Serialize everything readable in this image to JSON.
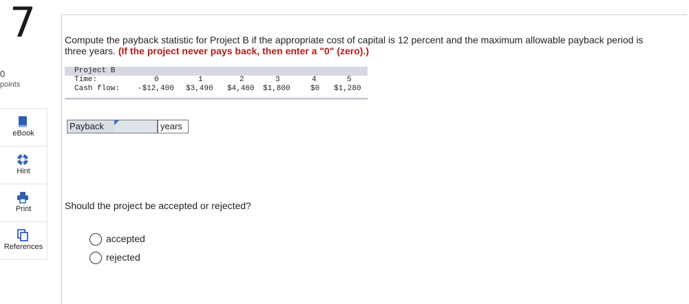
{
  "question_number": "7",
  "points": {
    "value": "0",
    "label": "points"
  },
  "rail": [
    {
      "label": "eBook",
      "icon": "ebook-icon"
    },
    {
      "label": "Hint",
      "icon": "hint-icon"
    },
    {
      "label": "Print",
      "icon": "print-icon"
    },
    {
      "label": "References",
      "icon": "references-icon"
    }
  ],
  "question": {
    "text": "Compute the payback statistic for Project B if the appropriate cost of capital is 12 percent and the maximum allowable payback period is three years. ",
    "bold": "(If the project never pays back, then enter a \"0\" (zero).)"
  },
  "cashflow": {
    "project": "Project B",
    "time_label": "Time:",
    "cf_label": "Cash flow:",
    "times": [
      "0",
      "1",
      "2",
      "3",
      "4",
      "5"
    ],
    "flows": [
      "-$12,400",
      "$3,490",
      "$4,460",
      "$1,800",
      "$0",
      "$1,280"
    ]
  },
  "payback": {
    "label": "Payback",
    "value": "",
    "unit": "years"
  },
  "accept_question": "Should the project be accepted or rejected?",
  "options": [
    "accepted",
    "rejected"
  ],
  "colors": {
    "header_bar": "#d6d9e1",
    "emphasis": "#b11c1c",
    "input_flag": "#3a72c9"
  }
}
